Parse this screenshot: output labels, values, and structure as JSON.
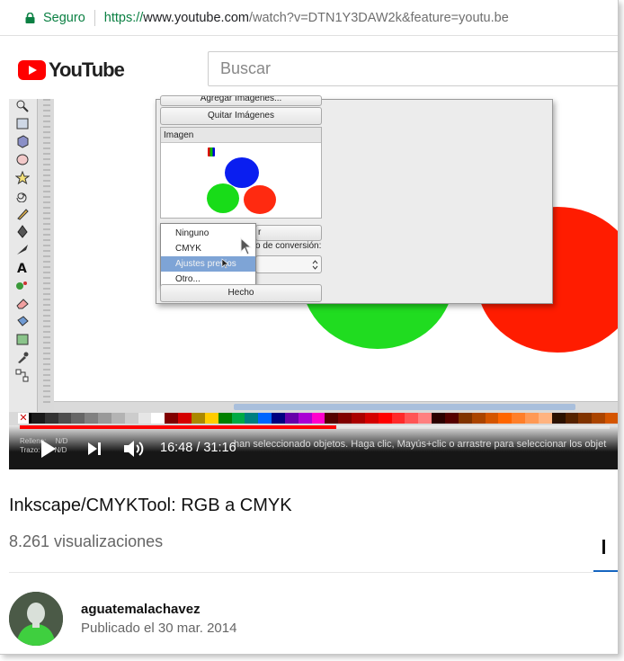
{
  "browser": {
    "secure_label": "Seguro",
    "url_scheme": "https://",
    "url_host": "www.youtube.com",
    "url_path": "/watch?v=DTN1Y3DAW2k&feature=youtu.be"
  },
  "header": {
    "logo_text": "YouTube",
    "search_placeholder": "Buscar"
  },
  "video_frame": {
    "dialog": {
      "add_images_button": "Agregar Imágenes...",
      "remove_images_button": "Quitar Imágenes",
      "image_panel_title": "Imagen",
      "dropdown_options": [
        "Ninguno",
        "CMYK",
        "Ajustes previos",
        "Otro..."
      ],
      "selected_option": "Ajustes previos",
      "conversion_label": "o de conversión:",
      "behind_button_text": "r",
      "done_button": "Hecho"
    },
    "status_bar": {
      "message": "han seleccionado objetos. Haga clic, Mayús+clic o arrastre para seleccionar los objet",
      "fill_label": "Relleno:",
      "fill_value": "N/D",
      "stroke_label": "Trazo:",
      "stroke_value": "N/D"
    },
    "palette": [
      "#000000",
      "#1a1a1a",
      "#333333",
      "#4d4d4d",
      "#666666",
      "#808080",
      "#999999",
      "#b3b3b3",
      "#cccccc",
      "#e6e6e6",
      "#ffffff",
      "#800000",
      "#d40000",
      "#aa8800",
      "#ffcc00",
      "#008000",
      "#00aa44",
      "#008080",
      "#0066ff",
      "#000080",
      "#6600aa",
      "#aa00d4",
      "#ff00cc",
      "#550000",
      "#800000",
      "#aa0000",
      "#d40000",
      "#ff0000",
      "#ff2a2a",
      "#ff5555",
      "#ff8080",
      "#2b0000",
      "#550000",
      "#803300",
      "#aa4400",
      "#d45500",
      "#ff6600",
      "#ff7f2a",
      "#ff9955",
      "#ffb380",
      "#2b1100",
      "#552200",
      "#803300",
      "#aa4400",
      "#d45500"
    ]
  },
  "player": {
    "current_time": "16:48",
    "duration": "31:16",
    "time_display": "16:48 / 31:16",
    "progress_fraction": 0.537
  },
  "video_info": {
    "title": "Inkscape/CMYKTool: RGB a CMYK",
    "views": "8.261 visualizaciones",
    "channel": "aguatemalachavez",
    "published": "Publicado el 30 mar. 2014"
  }
}
